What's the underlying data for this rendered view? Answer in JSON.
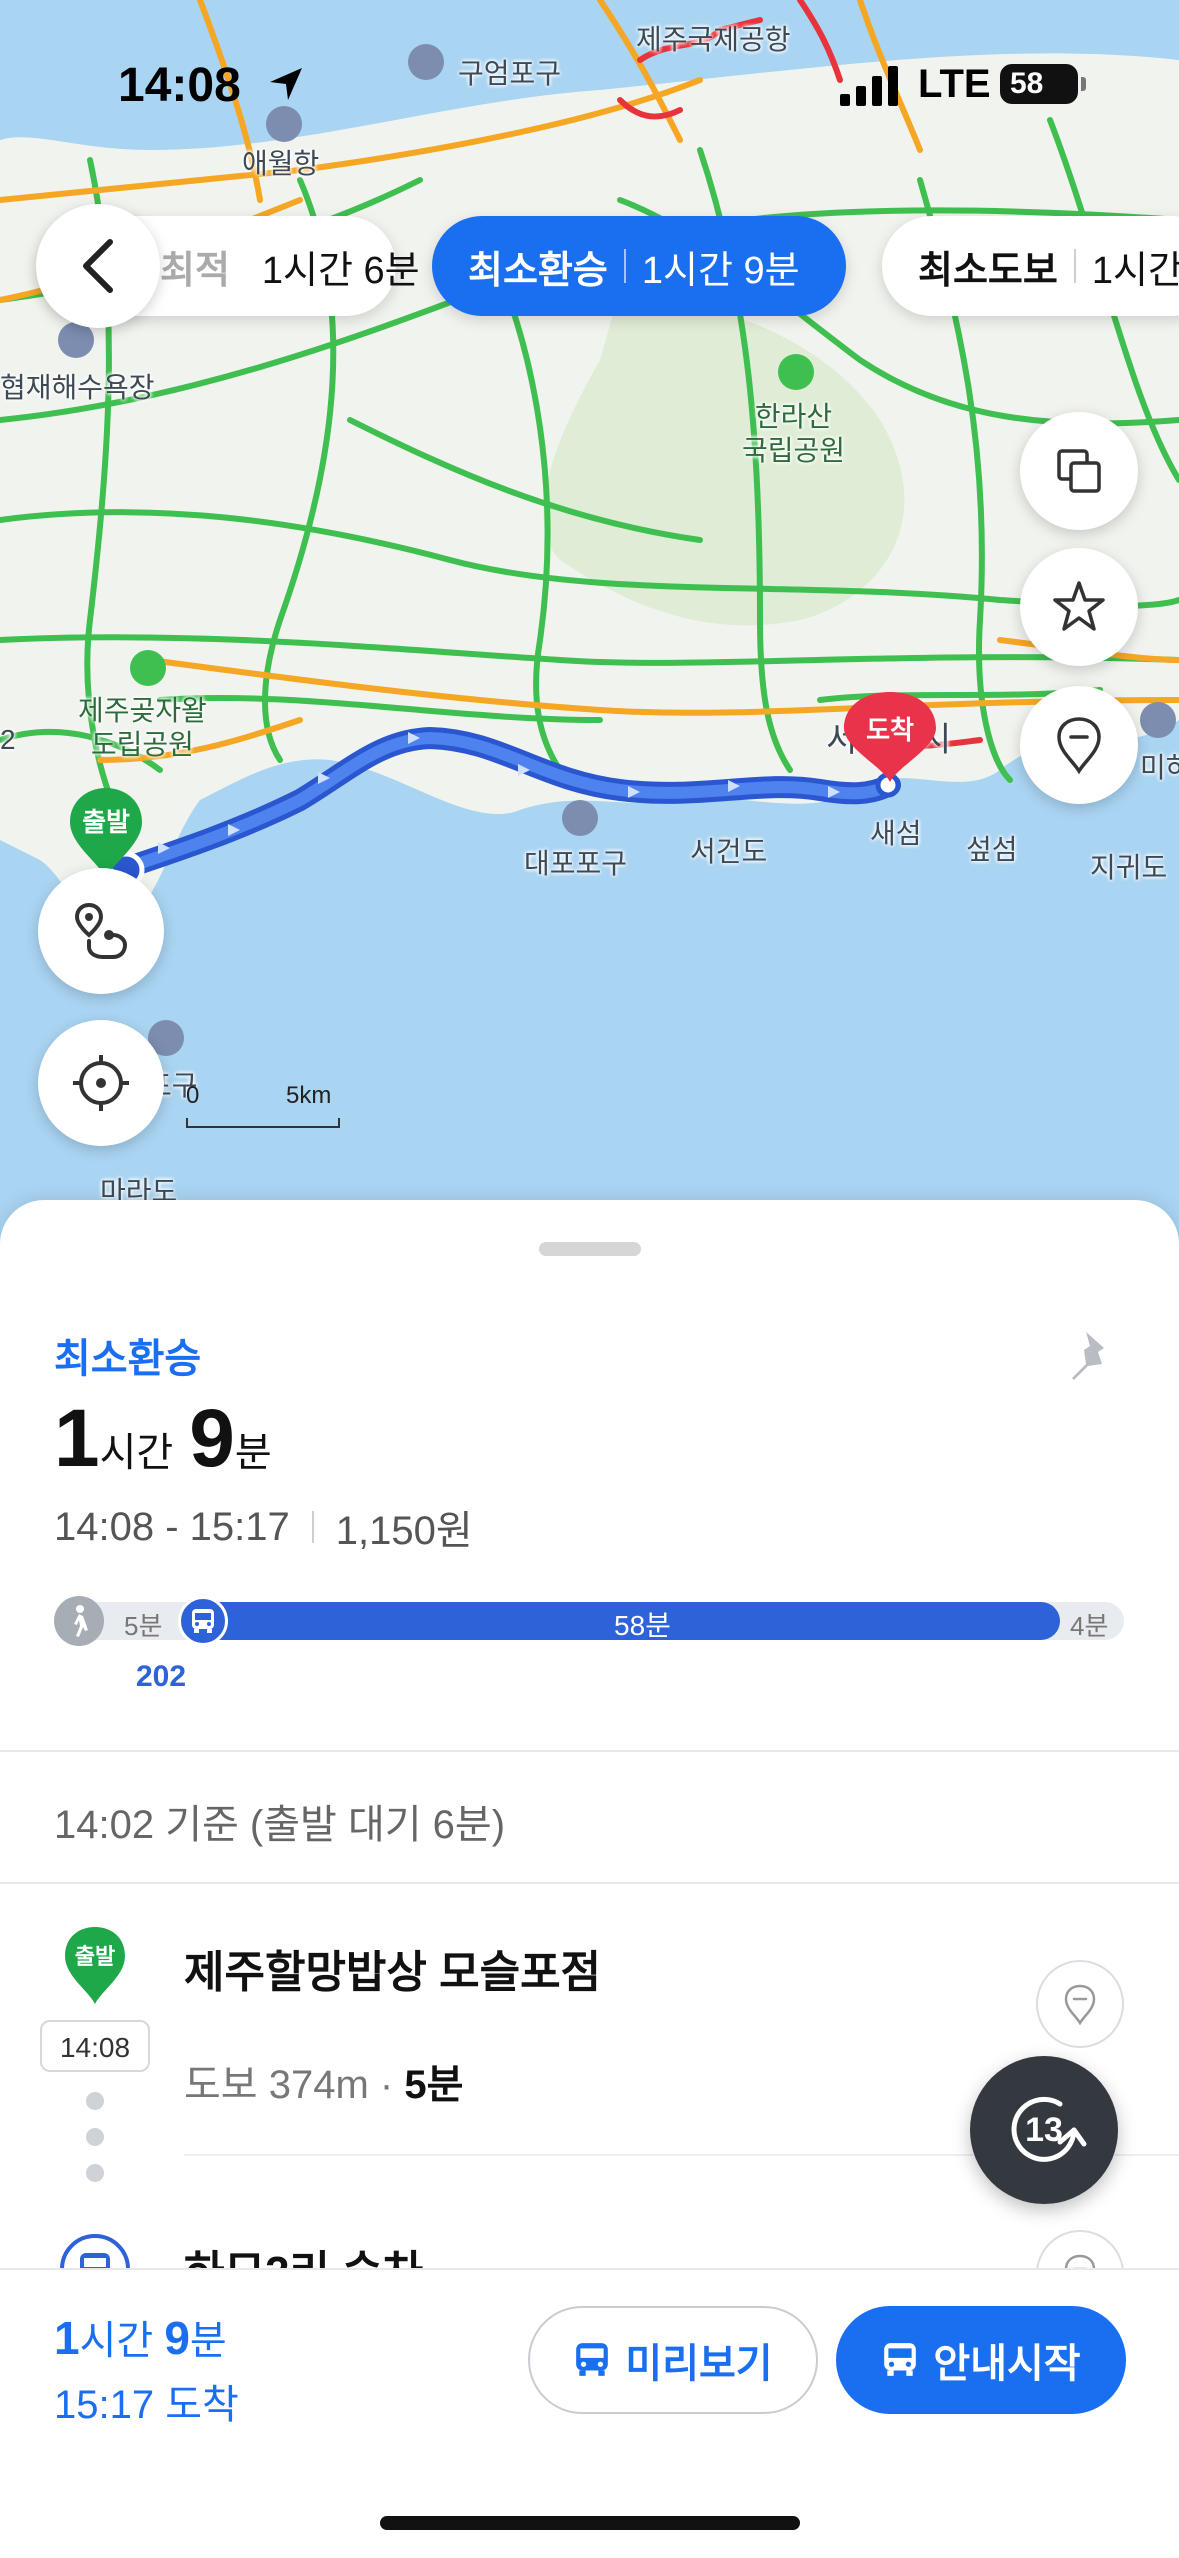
{
  "status_bar": {
    "time": "14:08",
    "network": "LTE",
    "battery": "58"
  },
  "map": {
    "labels": {
      "airport": "제주국제공항",
      "port1": "구엄포구",
      "port2": "애월항",
      "beach": "협재해수욕장",
      "park": "한라산\n국립공원",
      "forest": "제주곶자왈\n도립공원",
      "port3": "대포포구",
      "island1": "서건도",
      "island2": "새섬",
      "island3": "섶섬",
      "island4": "지귀도",
      "city": "서귀포시",
      "mara": "마라도",
      "moseulpo": "포구",
      "edge_num": "2",
      "edge_city": "미하"
    },
    "start_marker": "출발",
    "end_marker": "도착",
    "scale": {
      "zero": "0",
      "distance": "5km"
    }
  },
  "route_options": [
    {
      "name": "최적",
      "time": "1시간 6분"
    },
    {
      "name": "최소환승",
      "time": "1시간 9분",
      "active": true
    },
    {
      "name": "최소도보",
      "time": "1시간"
    }
  ],
  "summary": {
    "type": "최소환승",
    "hours": "1",
    "hour_unit": "시간",
    "minutes": "9",
    "minute_unit": "분",
    "time_range": "14:08 - 15:17",
    "fare": "1,150원",
    "timeline": {
      "walk_start": "5분",
      "bus": "58분",
      "walk_end": "4분",
      "bus_number": "202"
    }
  },
  "basis": "14:02 기준 (출발 대기 6분)",
  "steps": {
    "start_badge": "출발",
    "start_name": "제주할망밥상 모슬포점",
    "start_time": "14:08",
    "walk_label": "도보 374m",
    "walk_time": "5분",
    "board_name": "하모2리 승차"
  },
  "refresh_count": "13",
  "bottom": {
    "hours": "1",
    "hour_unit": "시간",
    "minutes": "9",
    "minute_unit": "분",
    "arrival": "15:17 도착",
    "preview_label": "미리보기",
    "start_label": "안내시작"
  }
}
